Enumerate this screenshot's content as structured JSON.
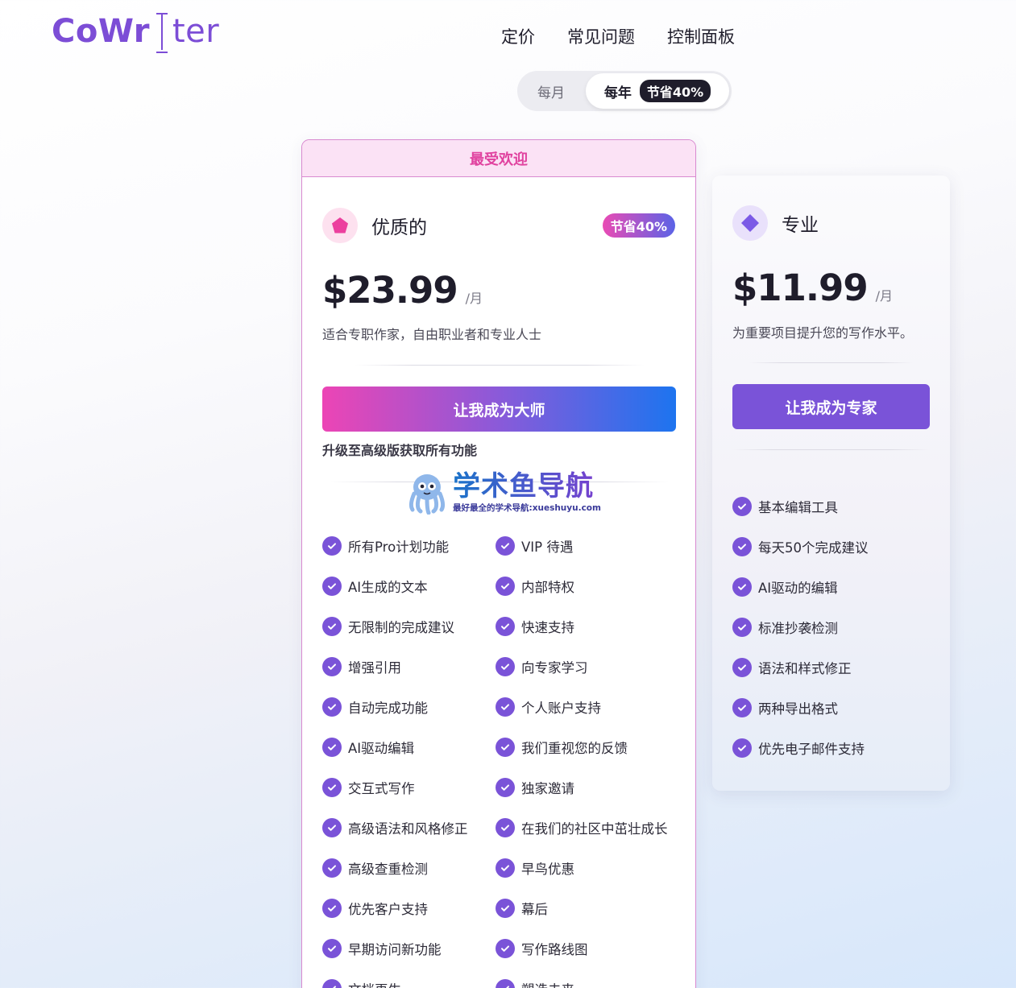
{
  "header": {
    "logo_left": "CoWr",
    "logo_right": "ter",
    "nav": [
      "定价",
      "常见问题",
      "控制面板"
    ]
  },
  "billing_toggle": {
    "monthly": "每月",
    "yearly": "每年",
    "yearly_badge": "节省40%"
  },
  "premium": {
    "ribbon": "最受欢迎",
    "name": "优质的",
    "save_badge": "节省40%",
    "price": "$23.99",
    "per": "/月",
    "desc": "适合专职作家，自由职业者和专业人士",
    "cta": "让我成为大师",
    "upgrade_note": "升级至高级版获取所有功能",
    "features": [
      "所有Pro计划功能",
      "VIP 待遇",
      "AI生成的文本",
      "内部特权",
      "无限制的完成建议",
      "快速支持",
      "增强引用",
      "向专家学习",
      "自动完成功能",
      "个人账户支持",
      "AI驱动编辑",
      "我们重视您的反馈",
      "交互式写作",
      "独家邀请",
      "高级语法和风格修正",
      "在我们的社区中茁壮成长",
      "高级查重检测",
      "早鸟优惠",
      "优先客户支持",
      "幕后",
      "早期访问新功能",
      "写作路线图",
      "文档再生",
      "塑造未来"
    ]
  },
  "pro": {
    "name": "专业",
    "price": "$11.99",
    "per": "/月",
    "desc": "为重要项目提升您的写作水平。",
    "cta": "让我成为专家",
    "features": [
      "基本编辑工具",
      "每天50个完成建议",
      "AI驱动的编辑",
      "标准抄袭检测",
      "语法和样式修正",
      "两种导出格式",
      "优先电子邮件支持"
    ]
  },
  "watermark": {
    "title": "学术鱼导航",
    "subtitle": "最好最全的学术导航:xueshuyu.com"
  },
  "colors": {
    "brand": "#7c4dd6",
    "accent_pink": "#e0429f",
    "check": "#7a53d8",
    "cta_blue": "#1d74ef"
  }
}
